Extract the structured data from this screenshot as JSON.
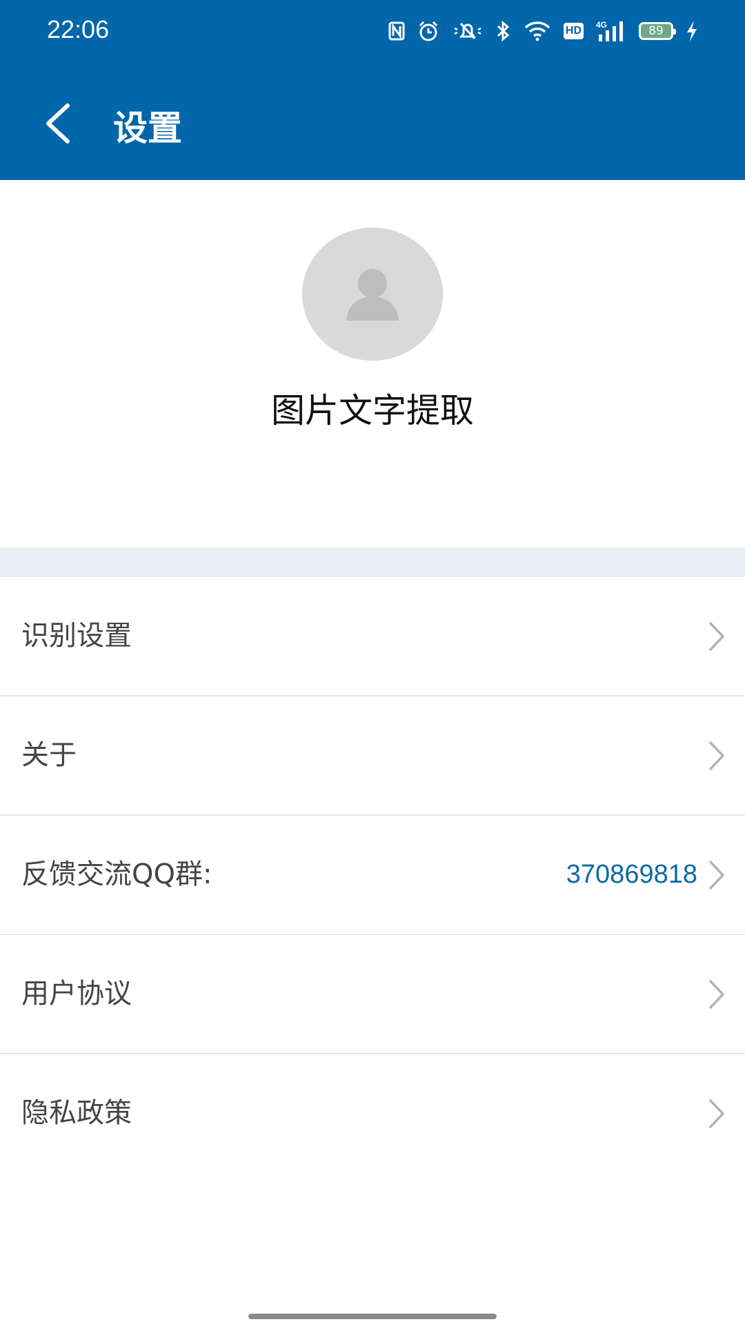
{
  "status_bar": {
    "time": "22:06",
    "icons": [
      "nfc-icon",
      "alarm-icon",
      "mute-icon",
      "bluetooth-icon",
      "wifi-icon",
      "hd-icon",
      "signal-4g-icon",
      "battery-icon",
      "charging-icon"
    ],
    "hd_label": "HD",
    "network_label": "4G",
    "battery_level": "89"
  },
  "header": {
    "title": "设置",
    "back_icon": "chevron-left-icon"
  },
  "profile": {
    "avatar_icon": "user-silhouette-icon",
    "app_name": "图片文字提取"
  },
  "menu": {
    "items": [
      {
        "label": "识别设置",
        "value": ""
      },
      {
        "label": "关于",
        "value": ""
      },
      {
        "label": "反馈交流QQ群:",
        "value": "370869818"
      },
      {
        "label": "用户协议",
        "value": ""
      },
      {
        "label": "隐私政策",
        "value": ""
      }
    ]
  },
  "colors": {
    "header_bg": "#0266aa",
    "accent_link": "#0a6aa6",
    "separator_band": "#e9edf4"
  }
}
